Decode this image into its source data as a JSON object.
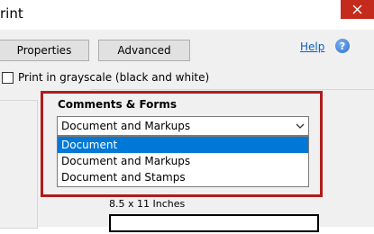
{
  "window": {
    "title": "rint",
    "close_label": "Close"
  },
  "toolbar": {
    "properties_label": "Properties",
    "advanced_label": "Advanced",
    "help_label": "Help"
  },
  "options": {
    "grayscale_label": "Print in grayscale (black and white)",
    "grayscale_checked": false
  },
  "comments_forms": {
    "label": "Comments & Forms",
    "selected_value": "Document and Markups",
    "dropdown_options": [
      {
        "label": "Document",
        "highlighted": true
      },
      {
        "label": "Document and Markups",
        "highlighted": false
      },
      {
        "label": "Document and Stamps",
        "highlighted": false
      }
    ]
  },
  "preview": {
    "paper_size": "8.5 x 11 Inches"
  },
  "colors": {
    "close_bg": "#c42b1c",
    "highlight_border": "#b01c1c",
    "selected_option_bg": "#0078d7",
    "link": "#0a5fc9"
  },
  "icons": {
    "close": "close-icon",
    "help": "help-question-icon",
    "dropdown": "chevron-down-icon"
  }
}
